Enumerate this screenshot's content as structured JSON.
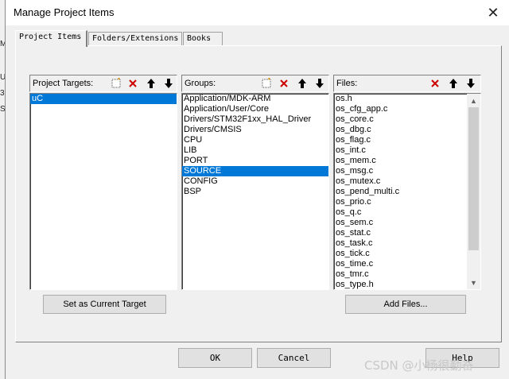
{
  "background": {
    "left_edge_fragments": [
      "M",
      "U",
      "3",
      "S"
    ]
  },
  "window": {
    "title": "Manage Project Items",
    "close_glyph": "✕"
  },
  "tabs": [
    {
      "label": "Project Items",
      "active": true
    },
    {
      "label": "Folders/Extensions",
      "active": false
    },
    {
      "label": "Books",
      "active": false
    }
  ],
  "targets": {
    "header": "Project Targets:",
    "items": [
      "uC"
    ],
    "selected": "uC",
    "set_current_label": "Set as Current Target"
  },
  "groups": {
    "header": "Groups:",
    "items": [
      "Application/MDK-ARM",
      "Application/User/Core",
      "Drivers/STM32F1xx_HAL_Driver",
      "Drivers/CMSIS",
      "CPU",
      "LIB",
      "PORT",
      "SOURCE",
      "CONFIG",
      "BSP"
    ],
    "selected": "SOURCE"
  },
  "files": {
    "header": "Files:",
    "items": [
      "os.h",
      "os_cfg_app.c",
      "os_core.c",
      "os_dbg.c",
      "os_flag.c",
      "os_int.c",
      "os_mem.c",
      "os_msg.c",
      "os_mutex.c",
      "os_pend_multi.c",
      "os_prio.c",
      "os_q.c",
      "os_sem.c",
      "os_stat.c",
      "os_task.c",
      "os_tick.c",
      "os_time.c",
      "os_tmr.c",
      "os_type.h"
    ],
    "add_files_label": "Add Files..."
  },
  "buttons": {
    "ok": "OK",
    "cancel": "Cancel",
    "help": "Help"
  },
  "watermark": "CSDN @小杨很勤奋",
  "colors": {
    "selection": "#0078d7",
    "delete_icon": "#cc0000",
    "dialog_bg": "#f0f0f0"
  }
}
